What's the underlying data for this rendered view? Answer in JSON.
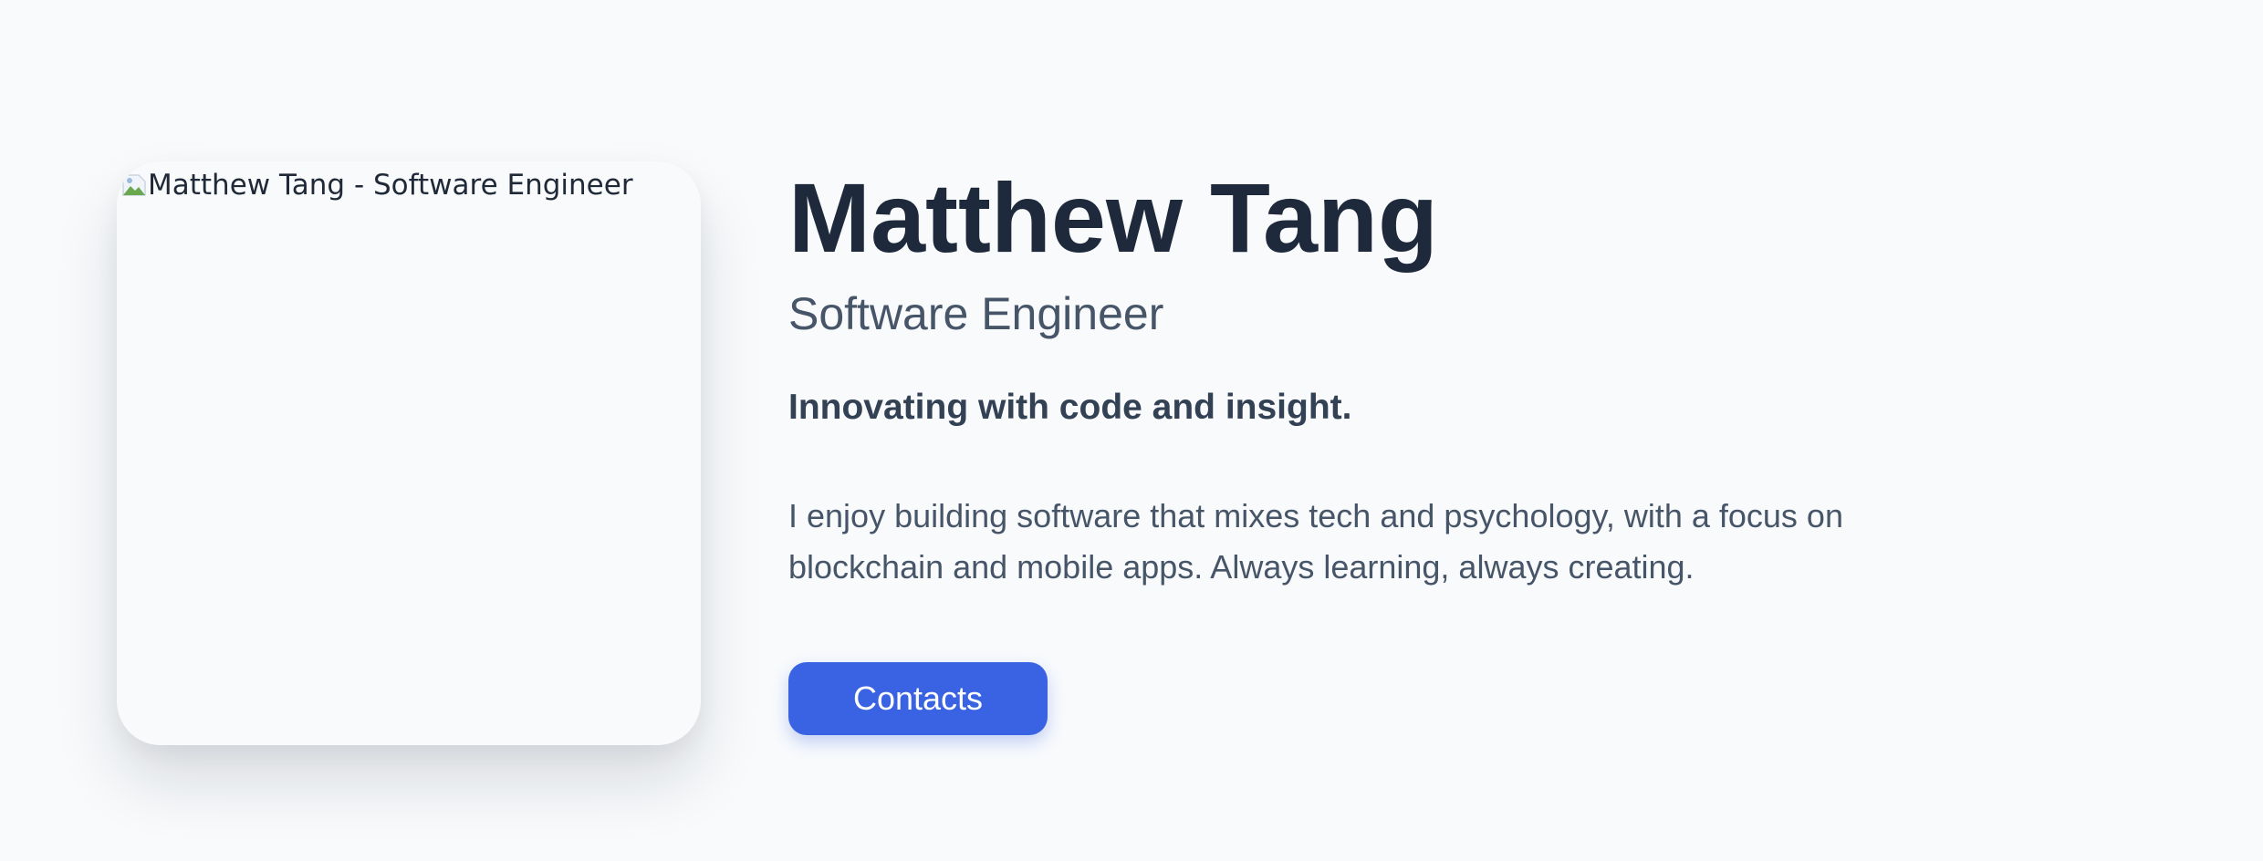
{
  "profile": {
    "photo_alt": "Matthew Tang - Software Engineer",
    "name": "Matthew Tang",
    "role": "Software Engineer",
    "tagline": "Innovating with code and insight.",
    "bio_line1": "I enjoy building software that mixes tech and psychology, with a focus on",
    "bio_line2": "blockchain and mobile apps. Always learning, always creating."
  },
  "actions": {
    "contacts_label": "Contacts"
  },
  "colors": {
    "background": "#f8fafc",
    "heading": "#1e293b",
    "body_text": "#475569",
    "accent": "#3a63e3"
  },
  "icons": {
    "photo_placeholder": "broken-image-icon"
  }
}
